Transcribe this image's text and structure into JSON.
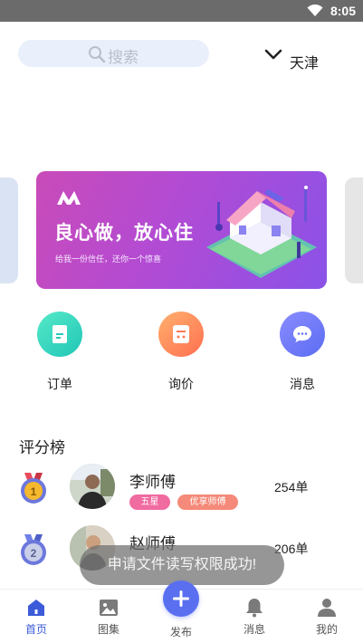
{
  "status_bar": {
    "time": "8:05"
  },
  "header": {
    "search_placeholder": "搜索",
    "city": "天津"
  },
  "banner": {
    "title": "良心做，放心住",
    "subtitle": "给我一份信任，还你一个惊喜"
  },
  "quick_actions": [
    {
      "label": "订单",
      "icon": "order-icon"
    },
    {
      "label": "询价",
      "icon": "inquiry-icon"
    },
    {
      "label": "消息",
      "icon": "chat-icon"
    }
  ],
  "ranking": {
    "title": "评分榜",
    "rows": [
      {
        "medal": "1",
        "name": "李师傅",
        "orders": "254单",
        "tags": [
          "五星",
          "优享师傅"
        ]
      },
      {
        "medal": "2",
        "name": "赵师傅",
        "orders": "206单",
        "tags": []
      }
    ]
  },
  "toast": "申请文件读写权限成功!",
  "tab_bar": [
    {
      "label": "首页",
      "icon": "home-icon",
      "active": true
    },
    {
      "label": "图集",
      "icon": "gallery-icon"
    },
    {
      "label": "发布",
      "icon": "plus-icon"
    },
    {
      "label": "消息",
      "icon": "bell-icon"
    },
    {
      "label": "我的",
      "icon": "user-icon"
    }
  ],
  "colors": {
    "accent": "#5a6ff0",
    "status_bar": "#6b6b6b",
    "banner_start": "#c94bb8",
    "banner_end": "#8a52e8"
  }
}
